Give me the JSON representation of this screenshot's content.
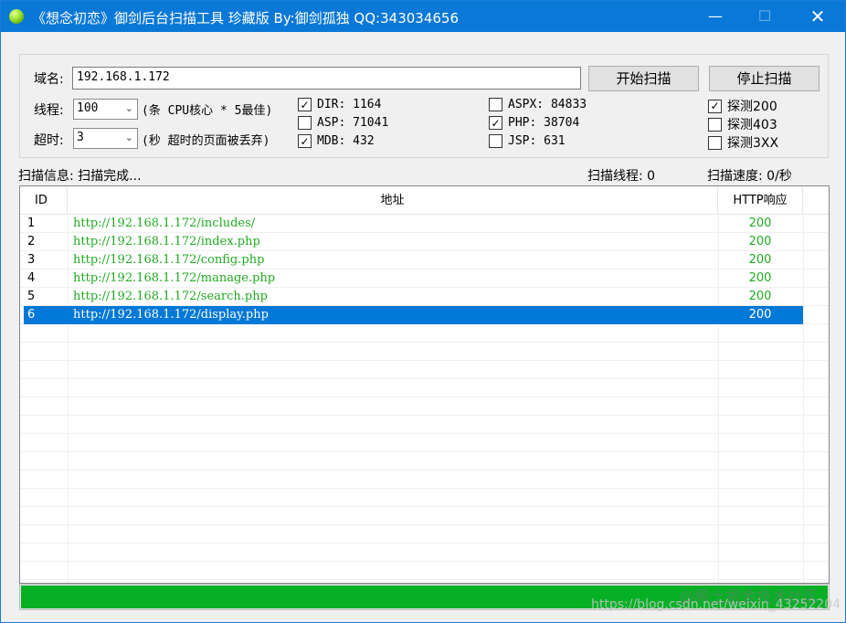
{
  "window": {
    "title": "《想念初恋》御剑后台扫描工具 珍藏版 By:御剑孤独 QQ:343034656",
    "minimize_glyph": "—",
    "maximize_glyph": "☐",
    "close_glyph": "✕"
  },
  "form": {
    "domain_label": "域名:",
    "domain_value": "192.168.1.172",
    "start_button": "开始扫描",
    "stop_button": "停止扫描",
    "threads_label": "线程:",
    "threads_value": "100",
    "threads_hint": "(条 CPU核心 * 5最佳)",
    "timeout_label": "超时:",
    "timeout_value": "3",
    "timeout_hint": "(秒 超时的页面被丢弃)"
  },
  "dictionaries": [
    {
      "label": "DIR: 1164",
      "checked": true
    },
    {
      "label": "ASP: 71041",
      "checked": false
    },
    {
      "label": "MDB: 432",
      "checked": true
    },
    {
      "label": "ASPX: 84833",
      "checked": false
    },
    {
      "label": "PHP: 38704",
      "checked": true
    },
    {
      "label": "JSP: 631",
      "checked": false
    }
  ],
  "probes": [
    {
      "label": "探测200",
      "checked": true
    },
    {
      "label": "探测403",
      "checked": false
    },
    {
      "label": "探测3XX",
      "checked": false
    }
  ],
  "check_glyph": "✓",
  "status": {
    "info": "扫描信息: 扫描完成...",
    "threads": "扫描线程: 0",
    "speed": "扫描速度: 0/秒"
  },
  "table": {
    "columns": [
      "ID",
      "地址",
      "HTTP响应"
    ],
    "rows": [
      {
        "id": "1",
        "url": "http://192.168.1.172/includes/",
        "code": "200",
        "selected": false
      },
      {
        "id": "2",
        "url": "http://192.168.1.172/index.php",
        "code": "200",
        "selected": false
      },
      {
        "id": "3",
        "url": "http://192.168.1.172/config.php",
        "code": "200",
        "selected": false
      },
      {
        "id": "4",
        "url": "http://192.168.1.172/manage.php",
        "code": "200",
        "selected": false
      },
      {
        "id": "5",
        "url": "http://192.168.1.172/search.php",
        "code": "200",
        "selected": false
      },
      {
        "id": "6",
        "url": "http://192.168.1.172/display.php",
        "code": "200",
        "selected": true
      }
    ]
  },
  "progress": {
    "fraction": 1.0,
    "color": "#06b025"
  },
  "watermark": {
    "line1": "@稀土掘金技术社区",
    "line2": "https://blog.csdn.net/weixin_43252204"
  }
}
